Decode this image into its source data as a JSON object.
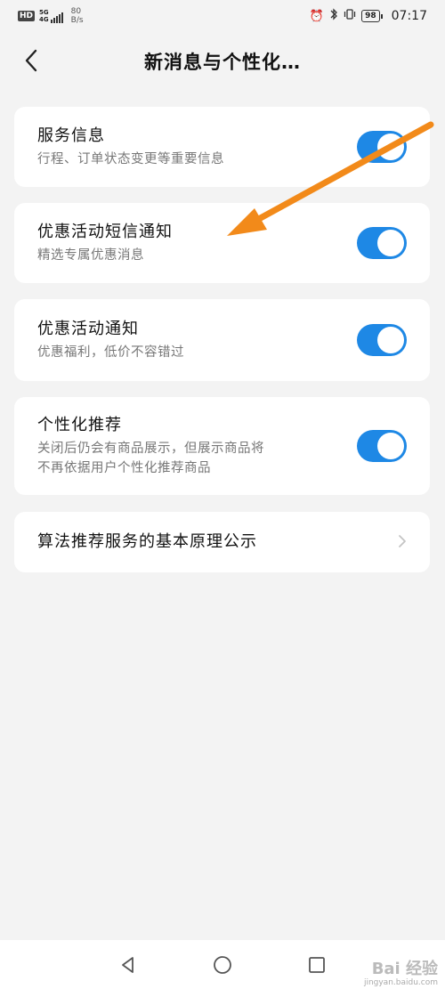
{
  "status_bar": {
    "hd": "HD",
    "network_top": "5G",
    "network_bottom": "4G",
    "speed_value": "80",
    "speed_unit": "B/s",
    "battery": "98",
    "time": "07:17"
  },
  "header": {
    "title": "新消息与个性化…"
  },
  "settings": [
    {
      "title": "服务信息",
      "desc": "行程、订单状态变更等重要信息",
      "enabled": true
    },
    {
      "title": "优惠活动短信通知",
      "desc": "精选专属优惠消息",
      "enabled": true
    },
    {
      "title": "优惠活动通知",
      "desc": "优惠福利，低价不容错过",
      "enabled": true
    },
    {
      "title": "个性化推荐",
      "desc_line1": "关闭后仍会有商品展示，但展示商品将",
      "desc_line2": "不再依据用户个性化推荐商品",
      "enabled": true
    }
  ],
  "link_item": {
    "label": "算法推荐服务的基本原理公示"
  },
  "colors": {
    "toggle_on": "#1e88e5",
    "annotation_arrow": "#f28a1a"
  },
  "watermark": {
    "logo": "Bai 经验",
    "url": "jingyan.baidu.com"
  }
}
